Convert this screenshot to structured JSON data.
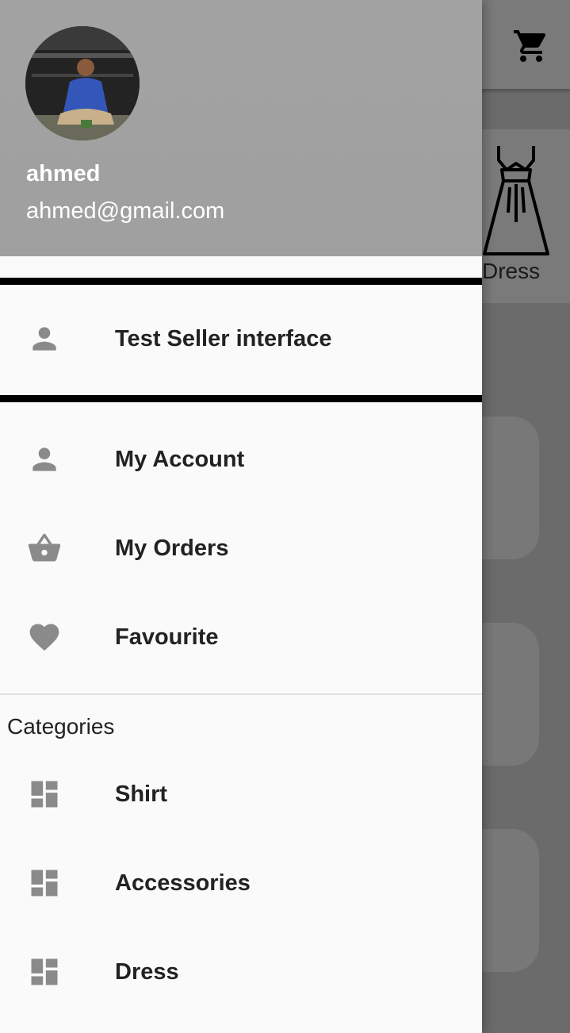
{
  "background": {
    "cart_icon": "shopping-cart-icon",
    "category_label": "Dress"
  },
  "drawer": {
    "account": {
      "name": "ahmed",
      "email": "ahmed@gmail.com"
    },
    "seller_item": {
      "label": "Test Seller interface",
      "icon": "person-icon"
    },
    "menu": [
      {
        "label": "My Account",
        "icon": "person-icon"
      },
      {
        "label": "My Orders",
        "icon": "basket-icon"
      },
      {
        "label": "Favourite",
        "icon": "heart-icon"
      }
    ],
    "categories_title": "Categories",
    "categories": [
      {
        "label": "Shirt",
        "icon": "dashboard-icon"
      },
      {
        "label": "Accessories",
        "icon": "dashboard-icon"
      },
      {
        "label": "Dress",
        "icon": "dashboard-icon"
      }
    ]
  },
  "colors": {
    "header_bg": "#a1a1a1",
    "drawer_bg": "#fafafa",
    "icon_gray": "#8a8a8a",
    "text_dark": "#222222"
  }
}
